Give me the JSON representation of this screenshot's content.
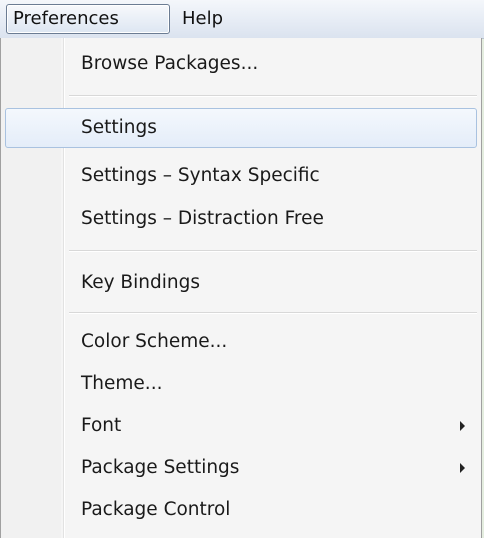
{
  "menubar": {
    "items": [
      {
        "label": "Preferences",
        "active": true
      },
      {
        "label": "Help",
        "active": false
      }
    ]
  },
  "dropdown": {
    "items": [
      {
        "label": "Browse Packages...",
        "highlighted": false,
        "submenu": false
      },
      {
        "label": "Settings",
        "highlighted": true,
        "submenu": false
      },
      {
        "label": "Settings – Syntax Specific",
        "highlighted": false,
        "submenu": false
      },
      {
        "label": "Settings – Distraction Free",
        "highlighted": false,
        "submenu": false
      },
      {
        "label": "Key Bindings",
        "highlighted": false,
        "submenu": false
      },
      {
        "label": "Color Scheme...",
        "highlighted": false,
        "submenu": false
      },
      {
        "label": "Theme...",
        "highlighted": false,
        "submenu": false
      },
      {
        "label": "Font",
        "highlighted": false,
        "submenu": true
      },
      {
        "label": "Package Settings",
        "highlighted": false,
        "submenu": true
      },
      {
        "label": "Package Control",
        "highlighted": false,
        "submenu": false
      }
    ]
  },
  "colors": {
    "highlight_border": "#a9c2e0",
    "menu_background": "#f5f5f5"
  }
}
